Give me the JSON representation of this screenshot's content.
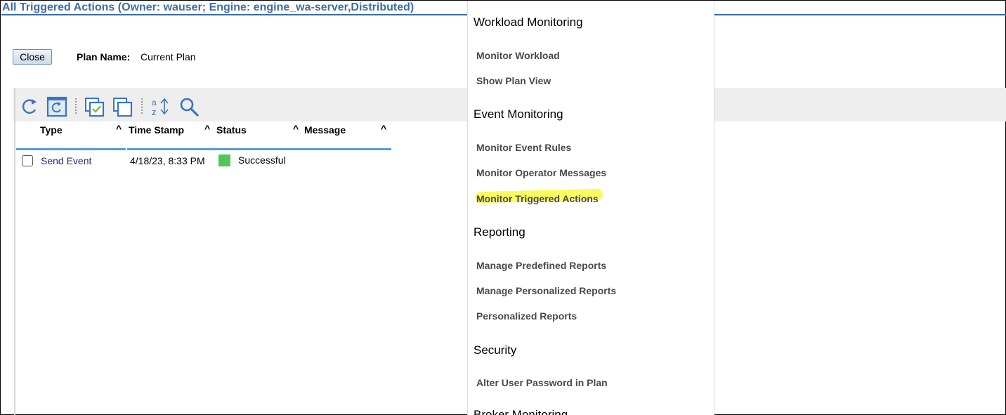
{
  "window": {
    "title": "All Triggered Actions (Owner: wauser; Engine: engine_wa-server,Distributed)"
  },
  "controls": {
    "close_label": "Close",
    "plan_label": "Plan Name:",
    "plan_value": "Current Plan"
  },
  "toolbar": {
    "icons": [
      "refresh-icon",
      "auto-refresh-icon",
      "select-all-icon",
      "deselect-all-icon",
      "sort-icon",
      "search-icon"
    ]
  },
  "table": {
    "columns": [
      "Type",
      "Time Stamp",
      "Status",
      "Message"
    ],
    "rows": [
      {
        "type": "Send Event",
        "time_stamp": "4/18/23, 8:33 PM",
        "status": "Successful",
        "status_color": "#50c65a",
        "message": ""
      }
    ]
  },
  "menu": {
    "sections": [
      {
        "title": "Workload Monitoring",
        "items": [
          "Monitor Workload",
          "Show Plan View"
        ]
      },
      {
        "title": "Event Monitoring",
        "items": [
          "Monitor Event Rules",
          "Monitor Operator Messages",
          "Monitor Triggered Actions"
        ]
      },
      {
        "title": "Reporting",
        "items": [
          "Manage Predefined Reports",
          "Manage Personalized Reports",
          "Personalized Reports"
        ]
      },
      {
        "title": "Security",
        "items": [
          "Alter User Password in Plan"
        ]
      },
      {
        "title": "Broker Monitoring",
        "items": []
      }
    ],
    "highlighted_item": "Monitor Triggered Actions",
    "highlight_color": "#f8fa28"
  },
  "colors": {
    "title": "#3a6ea5",
    "header_rule": "#4f9fe0",
    "link": "#1f2f7a"
  }
}
